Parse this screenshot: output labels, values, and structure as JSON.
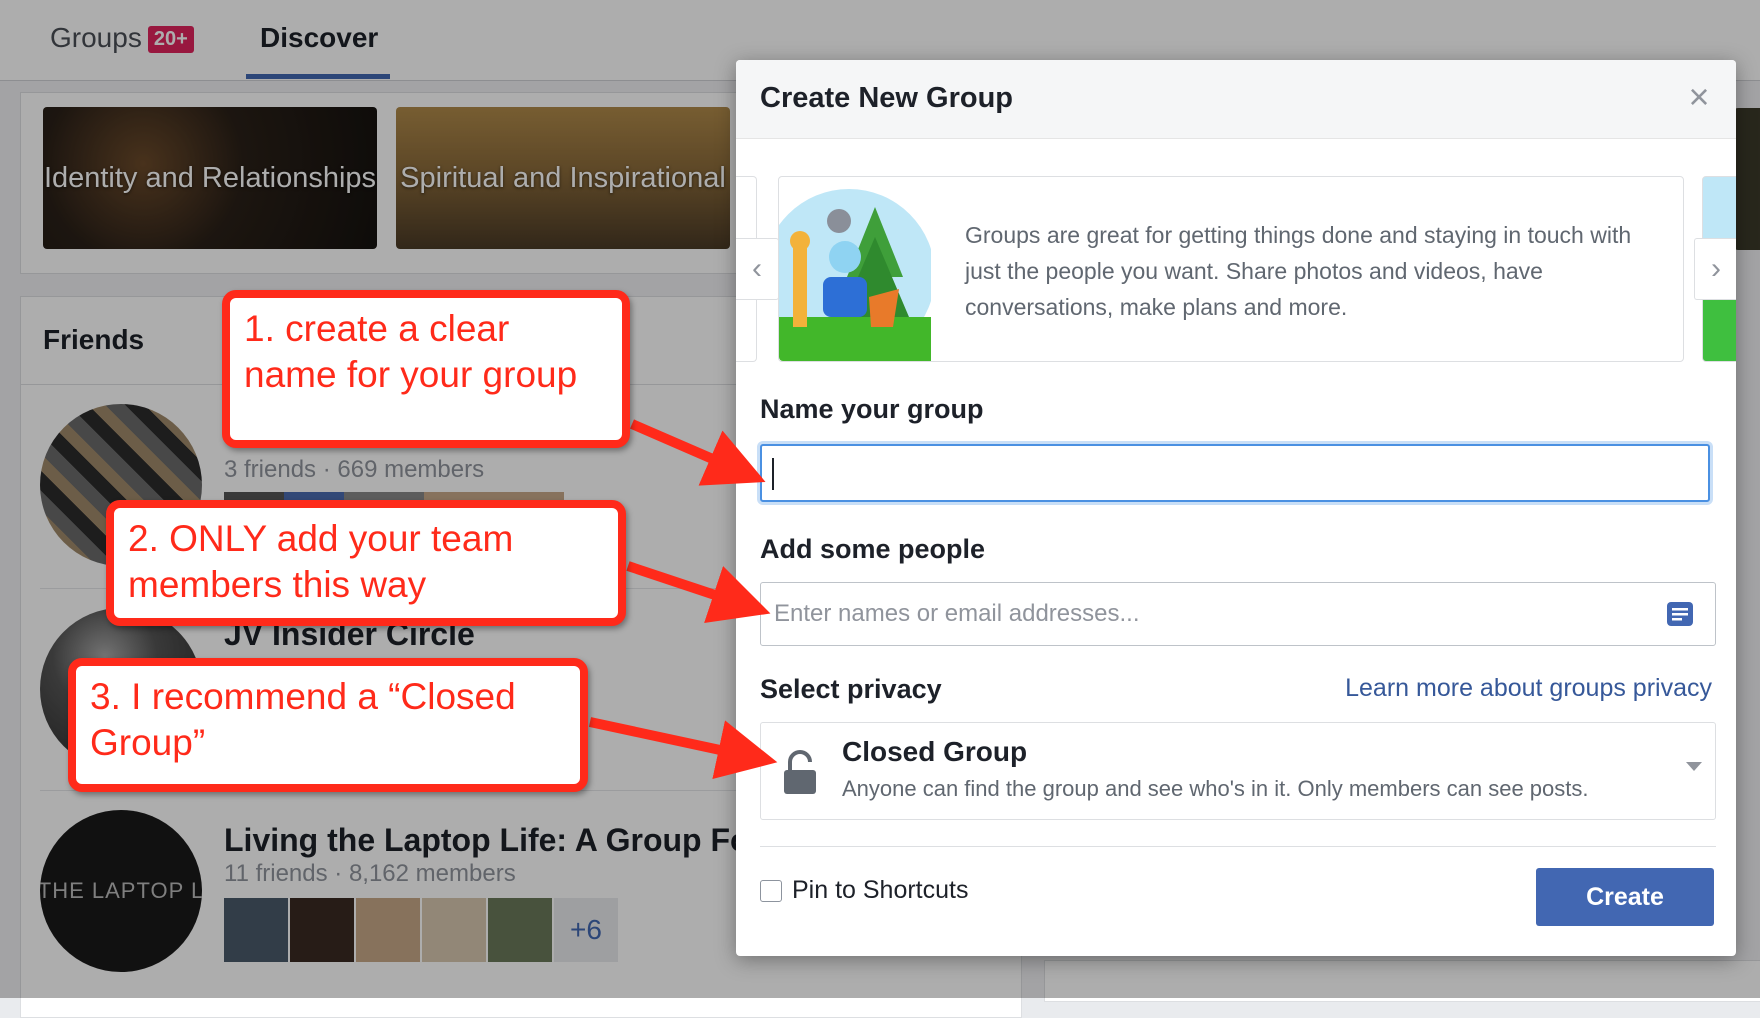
{
  "background": {
    "nav": {
      "tabs": [
        {
          "label": "Groups",
          "badge": "20+"
        },
        {
          "label": "Discover"
        }
      ]
    },
    "categories": [
      {
        "label": "Identity and Relationships"
      },
      {
        "label": "Spiritual and Inspirational"
      }
    ],
    "friends_section": {
      "title": "Friends",
      "groups": [
        {
          "meta": "3 friends · 669 members"
        },
        {
          "name": "JV Insider Circle"
        },
        {
          "name": "Living the Laptop Life: A Group Fo",
          "meta": "11 friends · 8,162 members",
          "avatar_text": "THE LAPTOP L",
          "more_count": "+6"
        }
      ]
    }
  },
  "modal": {
    "title": "Create New Group",
    "close_icon": "close-icon",
    "carousel": {
      "text": "Groups are great for getting things done and staying in touch with just the people you want. Share photos and videos, have conversations, make plans and more."
    },
    "name_label": "Name your group",
    "name_value": "",
    "people_label": "Add some people",
    "people_placeholder": "Enter names or email addresses...",
    "privacy_label": "Select privacy",
    "privacy_link": "Learn more about groups privacy",
    "privacy_selected": {
      "title": "Closed Group",
      "description": "Anyone can find the group and see who's in it. Only members can see posts."
    },
    "pin_label": "Pin to Shortcuts",
    "pin_checked": false,
    "create_label": "Create"
  },
  "annotations": [
    {
      "text": "1. create a clear name for your group"
    },
    {
      "text": "2. ONLY add your team members this way"
    },
    {
      "text": "3. I recommend a “Closed Group”"
    }
  ],
  "colors": {
    "accent": "#4267b2",
    "link": "#365899",
    "annotation": "#ff2a1a",
    "badge": "#e0245e"
  }
}
